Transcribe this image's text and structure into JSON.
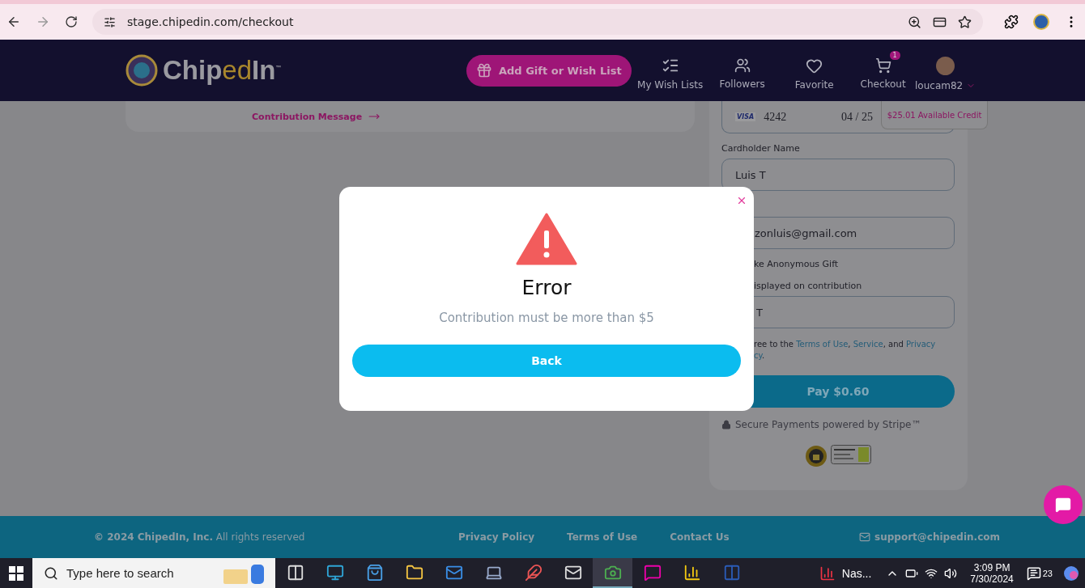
{
  "browser": {
    "url": "stage.chipedin.com/checkout"
  },
  "header": {
    "logo": [
      {
        "text": "Chip",
        "accent": false
      },
      {
        "text": "ed",
        "accent": true
      },
      {
        "text": "In",
        "accent": false
      }
    ],
    "logo_mark": "™",
    "add_button": "Add Gift or Wish List",
    "nav": [
      {
        "kind": "wishlist",
        "label": "My Wish Lists"
      },
      {
        "kind": "followers",
        "label": "Followers"
      },
      {
        "kind": "favorite",
        "label": "Favorite"
      },
      {
        "kind": "cart",
        "label": "Checkout",
        "badge": "1"
      },
      {
        "kind": "user",
        "label": "loucam82"
      }
    ]
  },
  "contribution_link": "Contribution Message",
  "payment": {
    "card_brand": "VISA",
    "card_number": "4242",
    "card_expiry": "04 / 25",
    "credit": "$25.01 Available Credit",
    "cardholder_label": "Cardholder Name",
    "cardholder_value": "Luis T",
    "email_value": "zonluis@gmail.com",
    "anonymous_label": "ke Anonymous Gift",
    "display_label": "isplayed on contribution",
    "display_value": "T",
    "terms_lines": [
      [
        {
          "text": "ree to the ",
          "link": false
        },
        {
          "text": "Terms of Use",
          "link": true
        },
        {
          "text": ", ",
          "link": false
        },
        {
          "text": "Service",
          "link": true
        },
        {
          "text": ", and ",
          "link": false
        },
        {
          "text": "Privacy",
          "link": true
        }
      ],
      [
        {
          "text": "cy",
          "link": true
        },
        {
          "text": ".",
          "link": false
        }
      ]
    ],
    "pay_button": "Pay $0.60",
    "secure_note": "Secure Payments powered by Stripe™"
  },
  "modal": {
    "title": "Error",
    "message": "Contribution must be more than $5",
    "button": "Back"
  },
  "footer": {
    "copyright": "**© 2024 ChipedIn, Inc.** All rights reserved",
    "links": [
      "Privacy Policy",
      "Terms of Use",
      "Contact Us"
    ],
    "email": "support@chipedin.com"
  },
  "taskbar": {
    "search_placeholder": "Type here to search",
    "running_app": "Nas...",
    "time": "3:09 PM",
    "date": "7/30/2024",
    "notifications": "23",
    "apps": [
      {
        "kind": "taskview",
        "selected": false
      },
      {
        "kind": "edge",
        "selected": false
      },
      {
        "kind": "store",
        "selected": false
      },
      {
        "kind": "folder",
        "selected": false
      },
      {
        "kind": "mail",
        "selected": false
      },
      {
        "kind": "laptop",
        "selected": false
      },
      {
        "kind": "paint",
        "selected": false
      },
      {
        "kind": "envelope",
        "selected": false
      },
      {
        "kind": "chrome",
        "selected": true
      },
      {
        "kind": "slack",
        "selected": false
      },
      {
        "kind": "powerbi",
        "selected": false
      },
      {
        "kind": "word",
        "selected": false
      }
    ]
  }
}
